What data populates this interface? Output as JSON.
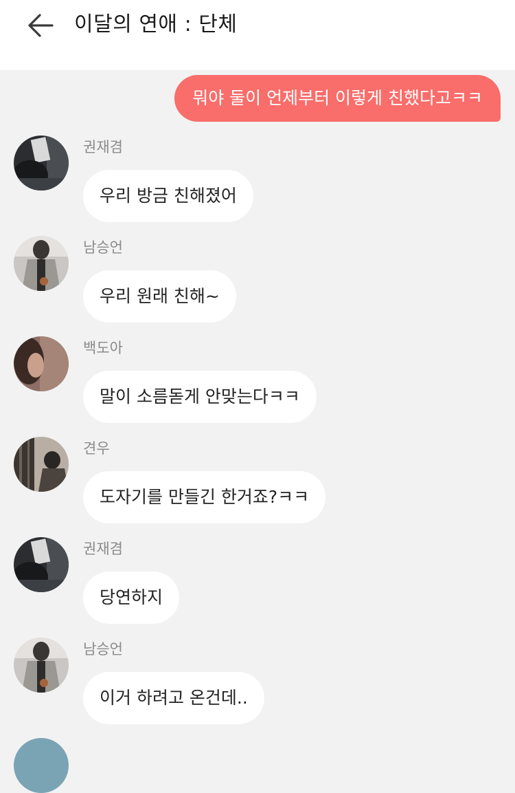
{
  "header": {
    "title": "이달의 연애 : 단체"
  },
  "icons": {
    "back": "arrow-left-icon"
  },
  "colors": {
    "my_bubble": "#f96d6a",
    "chat_background": "#f2f2f2",
    "bubble": "#ffffff",
    "sender_name": "#8a8a8a"
  },
  "my_message": {
    "text": "뭐야 둘이 언제부터 이렇게 친했다고ㅋㅋ"
  },
  "messages": [
    {
      "sender": "권재겸",
      "text": "우리 방금 친해졌어"
    },
    {
      "sender": "남승언",
      "text": "우리 원래 친해~"
    },
    {
      "sender": "백도아",
      "text": "말이 소름돋게 안맞는다ㅋㅋ"
    },
    {
      "sender": "견우",
      "text": "도자기를 만들긴 한거죠?ㅋㅋ"
    },
    {
      "sender": "권재겸",
      "text": "당연하지"
    },
    {
      "sender": "남승언",
      "text": "이거 하려고 온건데.."
    }
  ]
}
